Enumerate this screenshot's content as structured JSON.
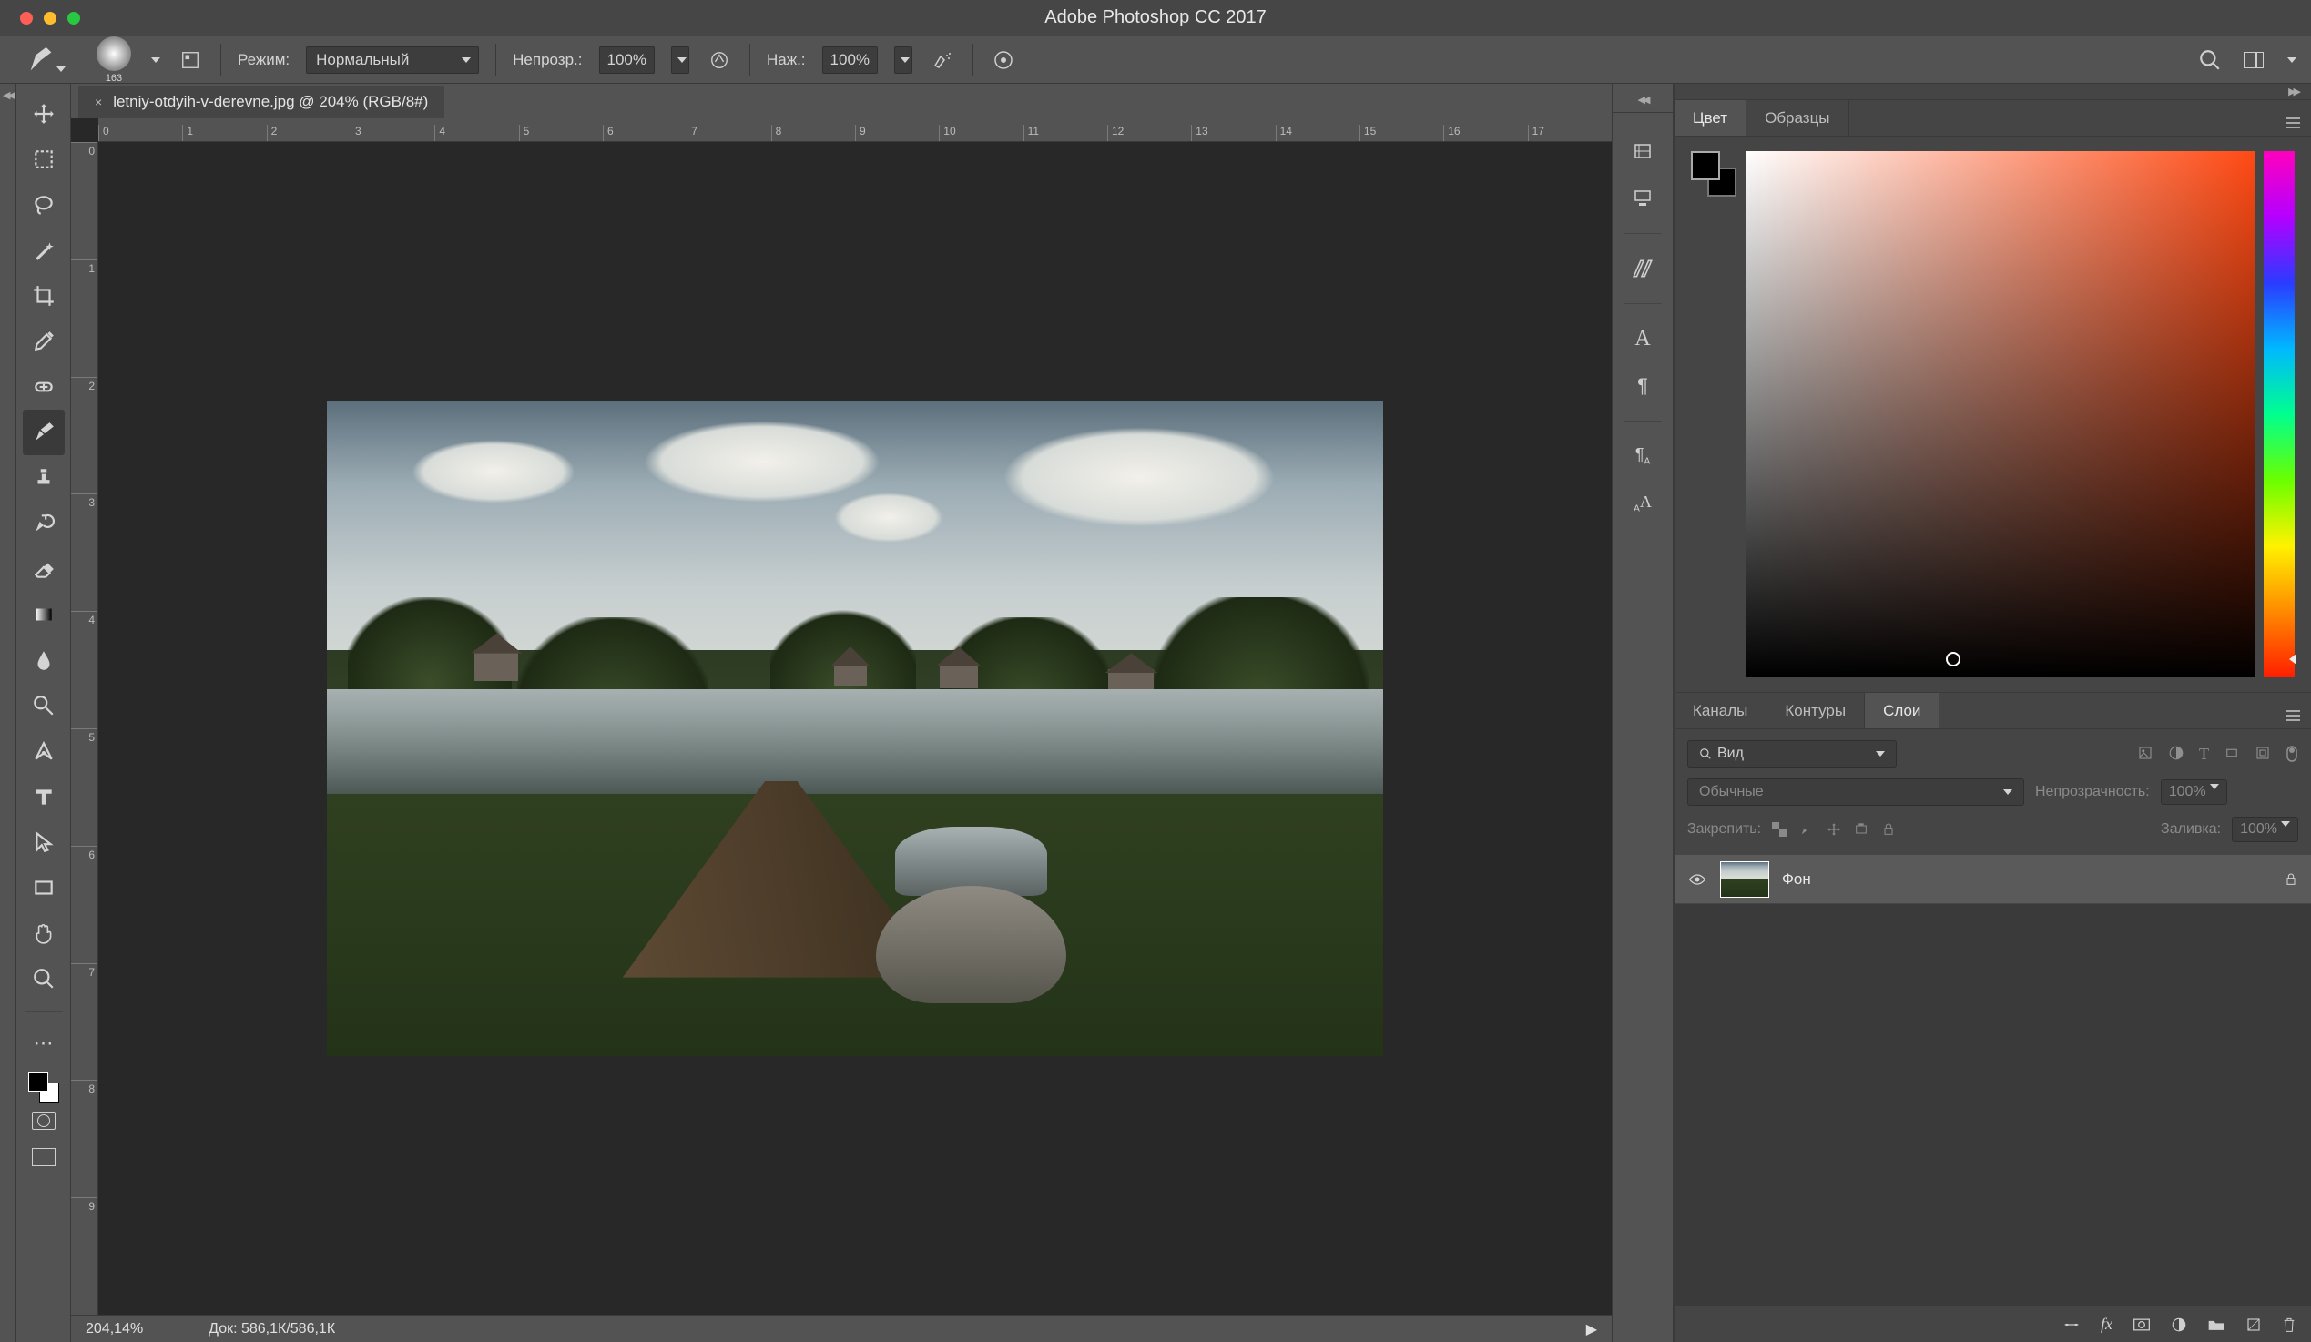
{
  "app_title": "Adobe Photoshop CC 2017",
  "options_bar": {
    "brush_size": "163",
    "mode_label": "Режим:",
    "mode_value": "Нормальный",
    "opacity_label": "Непрозр.:",
    "opacity_value": "100%",
    "flow_label": "Наж.:",
    "flow_value": "100%"
  },
  "document": {
    "tab_title": "letniy-otdyih-v-derevne.jpg @ 204% (RGB/8#)"
  },
  "ruler_h": [
    "0",
    "1",
    "2",
    "3",
    "4",
    "5",
    "6",
    "7",
    "8",
    "9",
    "10",
    "11",
    "12",
    "13",
    "14",
    "15",
    "16",
    "17"
  ],
  "ruler_v": [
    "0",
    "1",
    "2",
    "3",
    "4",
    "5",
    "6",
    "7",
    "8",
    "9"
  ],
  "statusbar": {
    "zoom": "204,14%",
    "doc_size": "Док: 586,1К/586,1К"
  },
  "panels": {
    "color": {
      "tab_color": "Цвет",
      "tab_swatches": "Образцы"
    },
    "layers": {
      "tab_channels": "Каналы",
      "tab_paths": "Контуры",
      "tab_layers": "Слои",
      "kind_placeholder": "Вид",
      "blend_mode": "Обычные",
      "opacity_label": "Непрозрачность:",
      "opacity_value": "100%",
      "lock_label": "Закрепить:",
      "fill_label": "Заливка:",
      "fill_value": "100%",
      "layer_name": "Фон"
    }
  }
}
